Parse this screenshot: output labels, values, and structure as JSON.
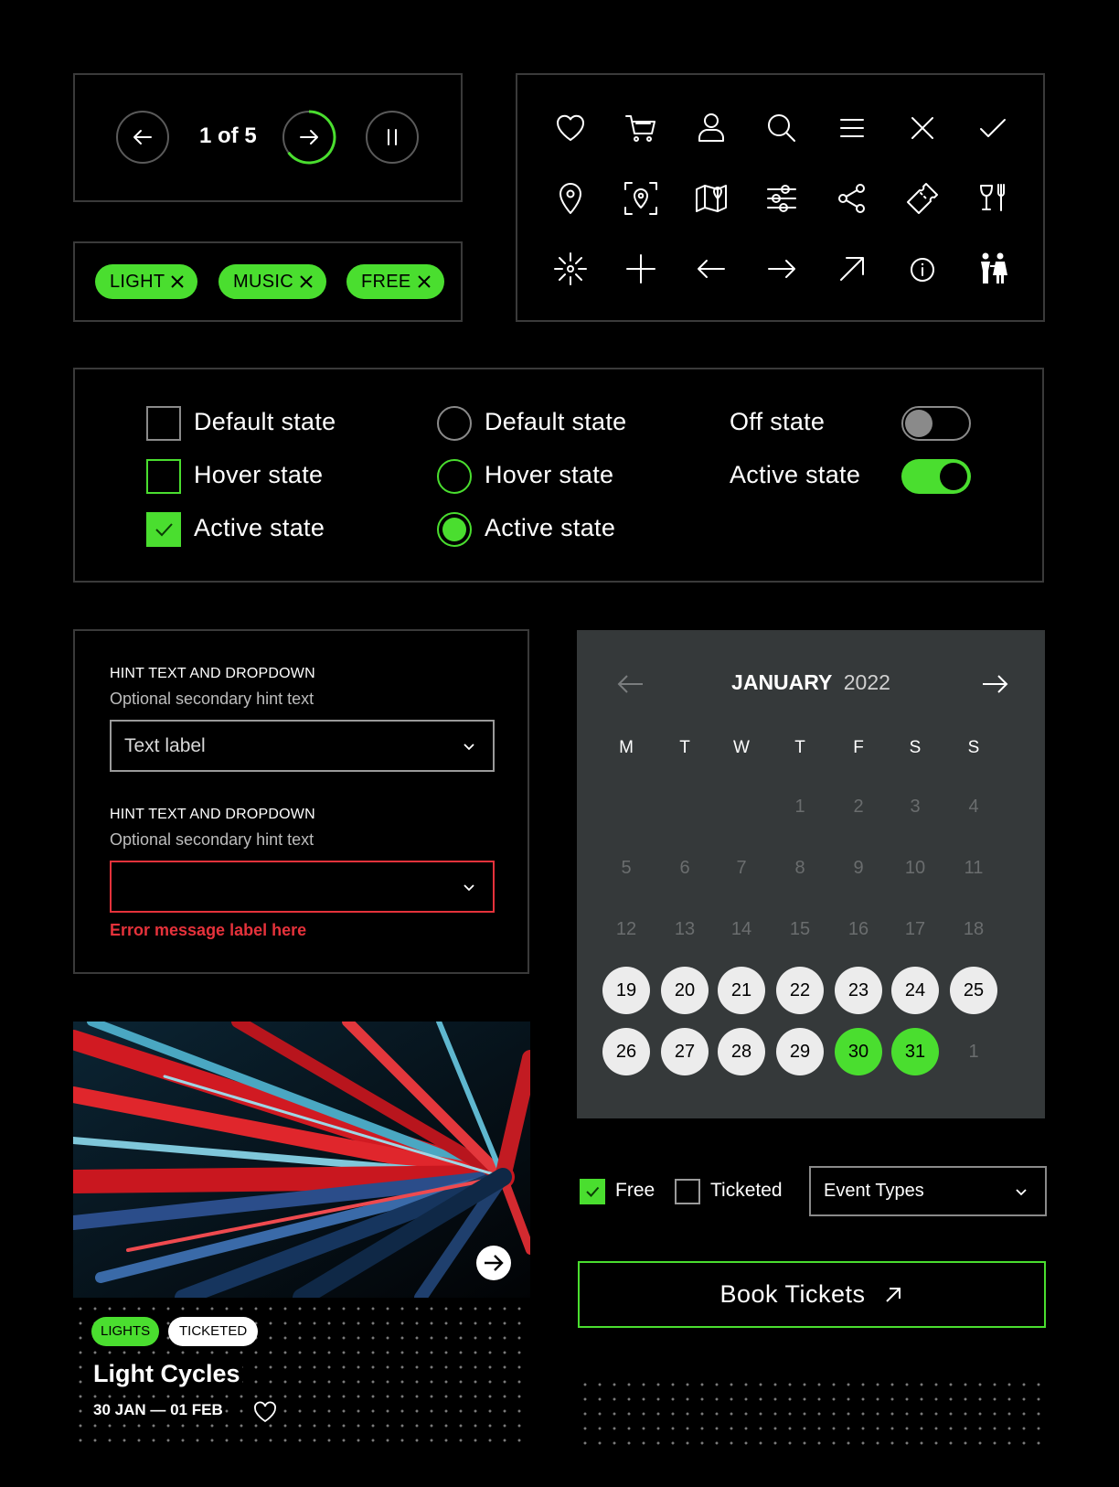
{
  "carousel": {
    "counter": "1 of 5"
  },
  "chips": [
    {
      "label": "LIGHT"
    },
    {
      "label": "MUSIC"
    },
    {
      "label": "FREE"
    }
  ],
  "icons": [
    "heart-icon",
    "cart-icon",
    "user-icon",
    "search-icon",
    "menu-icon",
    "close-icon",
    "check-icon",
    "map-pin-icon",
    "scan-location-icon",
    "map-icon",
    "sliders-icon",
    "share-icon",
    "ticket-icon",
    "dining-icon",
    "sparkle-icon",
    "plus-icon",
    "arrow-left-icon",
    "arrow-right-icon",
    "arrow-up-right-icon",
    "info-icon",
    "couple-icon"
  ],
  "states": {
    "checkbox": [
      "Default state",
      "Hover state",
      "Active state"
    ],
    "radio": [
      "Default state",
      "Hover state",
      "Active state"
    ],
    "toggle": [
      "Off state",
      "Active state"
    ]
  },
  "form": {
    "field1": {
      "title": "HINT TEXT AND DROPDOWN",
      "hint": "Optional secondary hint text",
      "value": "Text label"
    },
    "field2": {
      "title": "HINT TEXT AND DROPDOWN",
      "hint": "Optional secondary hint text",
      "value": "",
      "error": "Error message label here"
    }
  },
  "calendar": {
    "month": "JANUARY",
    "year": "2022",
    "weekdays": [
      "M",
      "T",
      "W",
      "T",
      "F",
      "S",
      "S"
    ],
    "weeks": [
      [
        null,
        null,
        null,
        {
          "d": "1",
          "s": "dim"
        },
        {
          "d": "2",
          "s": "dim"
        },
        {
          "d": "3",
          "s": "dim"
        },
        {
          "d": "4",
          "s": "dim"
        }
      ],
      [
        {
          "d": "5",
          "s": "dim"
        },
        {
          "d": "6",
          "s": "dim"
        },
        {
          "d": "7",
          "s": "dim"
        },
        {
          "d": "8",
          "s": "dim"
        },
        {
          "d": "9",
          "s": "dim"
        },
        {
          "d": "10",
          "s": "dim"
        },
        {
          "d": "11",
          "s": "dim"
        }
      ],
      [
        {
          "d": "12",
          "s": "dim"
        },
        {
          "d": "13",
          "s": "dim"
        },
        {
          "d": "14",
          "s": "dim"
        },
        {
          "d": "15",
          "s": "dim"
        },
        {
          "d": "16",
          "s": "dim"
        },
        {
          "d": "17",
          "s": "dim"
        },
        {
          "d": "18",
          "s": "dim"
        }
      ],
      [
        {
          "d": "19",
          "s": "on"
        },
        {
          "d": "20",
          "s": "on"
        },
        {
          "d": "21",
          "s": "on"
        },
        {
          "d": "22",
          "s": "on"
        },
        {
          "d": "23",
          "s": "on"
        },
        {
          "d": "24",
          "s": "on"
        },
        {
          "d": "25",
          "s": "on"
        }
      ],
      [
        {
          "d": "26",
          "s": "on"
        },
        {
          "d": "27",
          "s": "on"
        },
        {
          "d": "28",
          "s": "on"
        },
        {
          "d": "29",
          "s": "on"
        },
        {
          "d": "30",
          "s": "sel"
        },
        {
          "d": "31",
          "s": "sel"
        },
        {
          "d": "1",
          "s": "dim"
        }
      ]
    ]
  },
  "filters": {
    "free": "Free",
    "ticketed": "Ticketed",
    "event_types": "Event Types"
  },
  "cta": {
    "label": "Book Tickets"
  },
  "event_card": {
    "tags": [
      "LIGHTS",
      "TICKETED"
    ],
    "title": "Light Cycles",
    "dates": "30 JAN — 01 FEB"
  },
  "colors": {
    "accent": "#4ade2f",
    "error": "#e5323b",
    "panel_border": "#3a3a3a",
    "calendar_bg": "#35393a"
  }
}
